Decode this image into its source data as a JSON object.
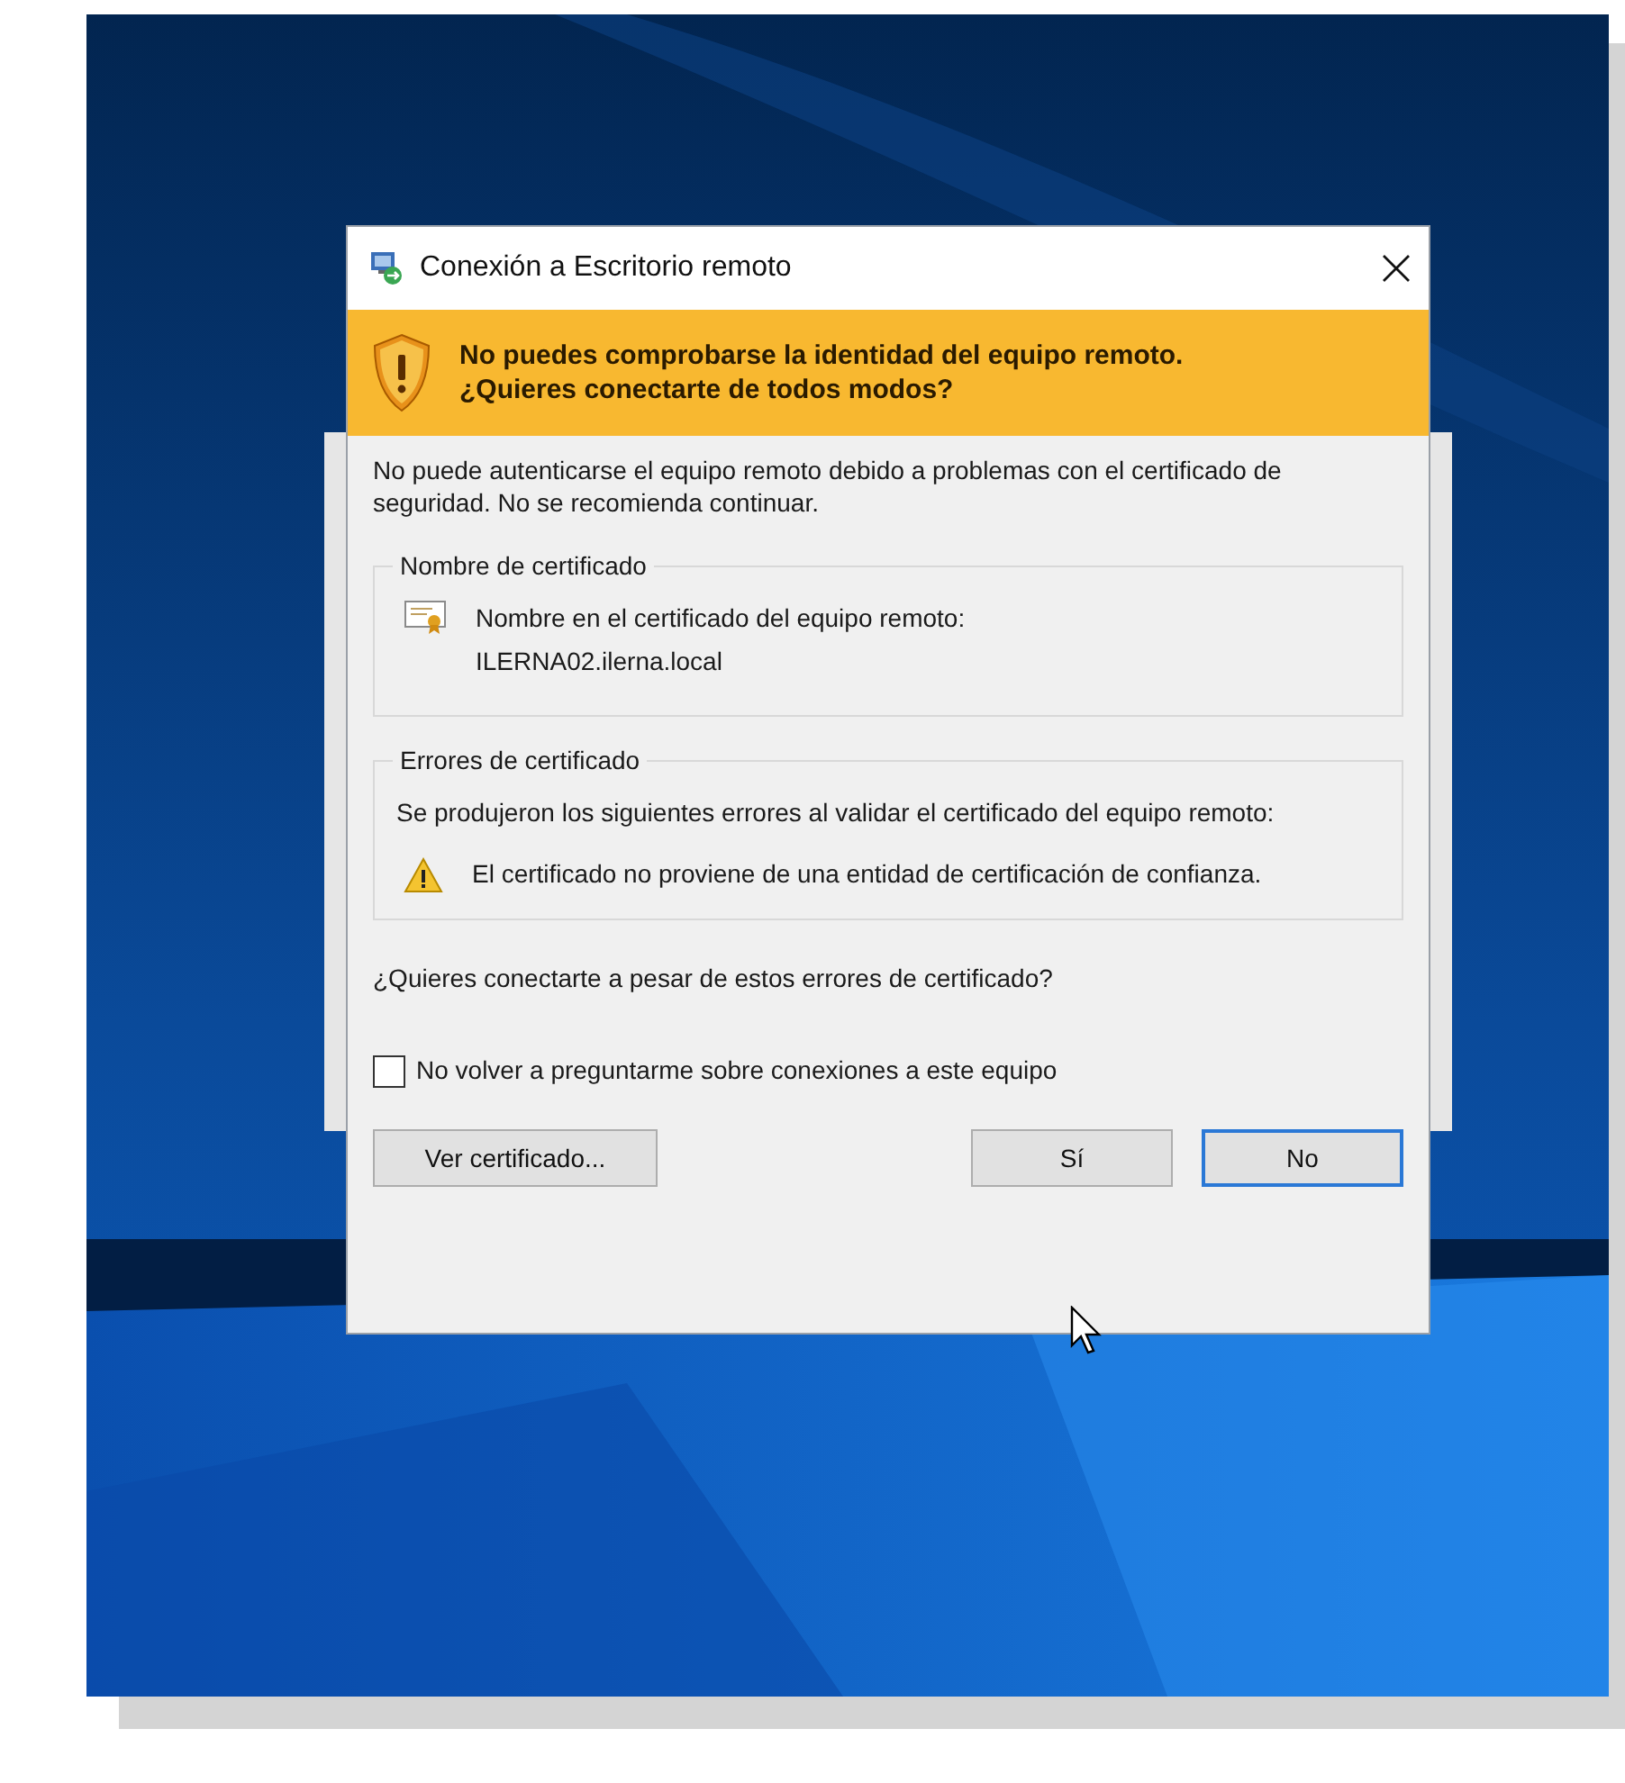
{
  "window": {
    "title": "Conexión a Escritorio remoto"
  },
  "banner": {
    "lines": [
      "No puedes comprobarse la identidad del equipo remoto.",
      "¿Quieres conectarte de todos modos?"
    ]
  },
  "intro": "No puede autenticarse el equipo remoto debido a problemas con el certificado de seguridad. No se recomienda continuar.",
  "groups": [
    {
      "kind": "certificate",
      "title": "Nombre de certificado",
      "lines": [
        "Nombre en el certificado del equipo remoto:",
        "ILERNA02.ilerna.local"
      ]
    },
    {
      "kind": "errors",
      "title": "Errores de certificado",
      "text": "Se produjeron los siguientes errores al validar el certificado del equipo remoto:",
      "errors": [
        "El certificado no proviene de una entidad de certificación de confianza."
      ]
    }
  ],
  "question": "¿Quieres conectarte a pesar de estos errores de certificado?",
  "checkbox": {
    "label": "No volver a preguntarme sobre conexiones a este equipo",
    "checked": false
  },
  "certificate_button": {
    "label": "Ver certificado...",
    "default": false
  },
  "buttons": [
    {
      "label": "Sí",
      "default": false
    },
    {
      "label": "No",
      "default": true
    }
  ]
}
